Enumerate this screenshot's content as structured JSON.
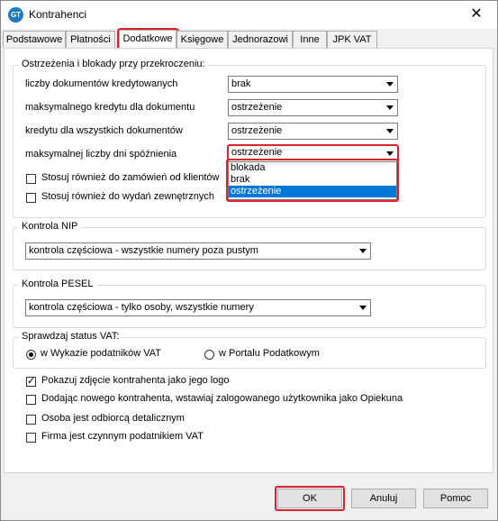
{
  "window": {
    "title": "Kontrahenci",
    "app_icon": "GT",
    "close_glyph": "✕"
  },
  "tabs": [
    "Podstawowe",
    "Płatności",
    "Dodatkowe",
    "Księgowe",
    "Jednorazowi",
    "Inne",
    "JPK VAT"
  ],
  "active_tab": "Dodatkowe",
  "warnings": {
    "title": "Ostrzeżenia i blokady przy przekroczeniu:",
    "rows": [
      {
        "label": "liczby dokumentów kredytowanych",
        "value": "brak"
      },
      {
        "label": "maksymalnego kredytu dla  dokumentu",
        "value": "ostrzeżenie"
      },
      {
        "label": "kredytu dla wszystkich dokumentów",
        "value": "ostrzeżenie"
      },
      {
        "label": "maksymalnej liczby dni spóźnienia",
        "value": "ostrzeżenie"
      }
    ],
    "dropdown_options": [
      "blokada",
      "brak",
      "ostrzeżenie"
    ],
    "dropdown_selected": "ostrzeżenie",
    "checks": [
      {
        "label": "Stosuj również do zamówień od klientów",
        "checked": false
      },
      {
        "label": "Stosuj również do wydań zewnętrznych",
        "checked": false
      }
    ]
  },
  "nip": {
    "title": "Kontrola NIP",
    "value": "kontrola częściowa - wszystkie numery poza pustym"
  },
  "pesel": {
    "title": "Kontrola PESEL",
    "value": "kontrola częściowa - tylko osoby, wszystkie numery"
  },
  "vat": {
    "title": "Sprawdzaj status VAT:",
    "option1": "w Wykazie podatników VAT",
    "option2": "w Portalu Podatkowym",
    "selected": "w Wykazie podatników VAT"
  },
  "options": [
    {
      "label": "Pokazuj zdjęcie kontrahenta jako jego logo",
      "checked": true
    },
    {
      "label": "Dodając nowego kontrahenta, wstawiaj zalogowanego użytkownika jako Opiekuna",
      "checked": false
    },
    {
      "label": "Osoba jest odbiorcą detalicznym",
      "checked": false
    },
    {
      "label": "Firma jest czynnym podatnikiem VAT",
      "checked": false
    }
  ],
  "buttons": {
    "ok": "OK",
    "cancel": "Anuluj",
    "help": "Pomoc"
  },
  "colors": {
    "highlight": "#d9232d",
    "selection": "#0078d7"
  }
}
